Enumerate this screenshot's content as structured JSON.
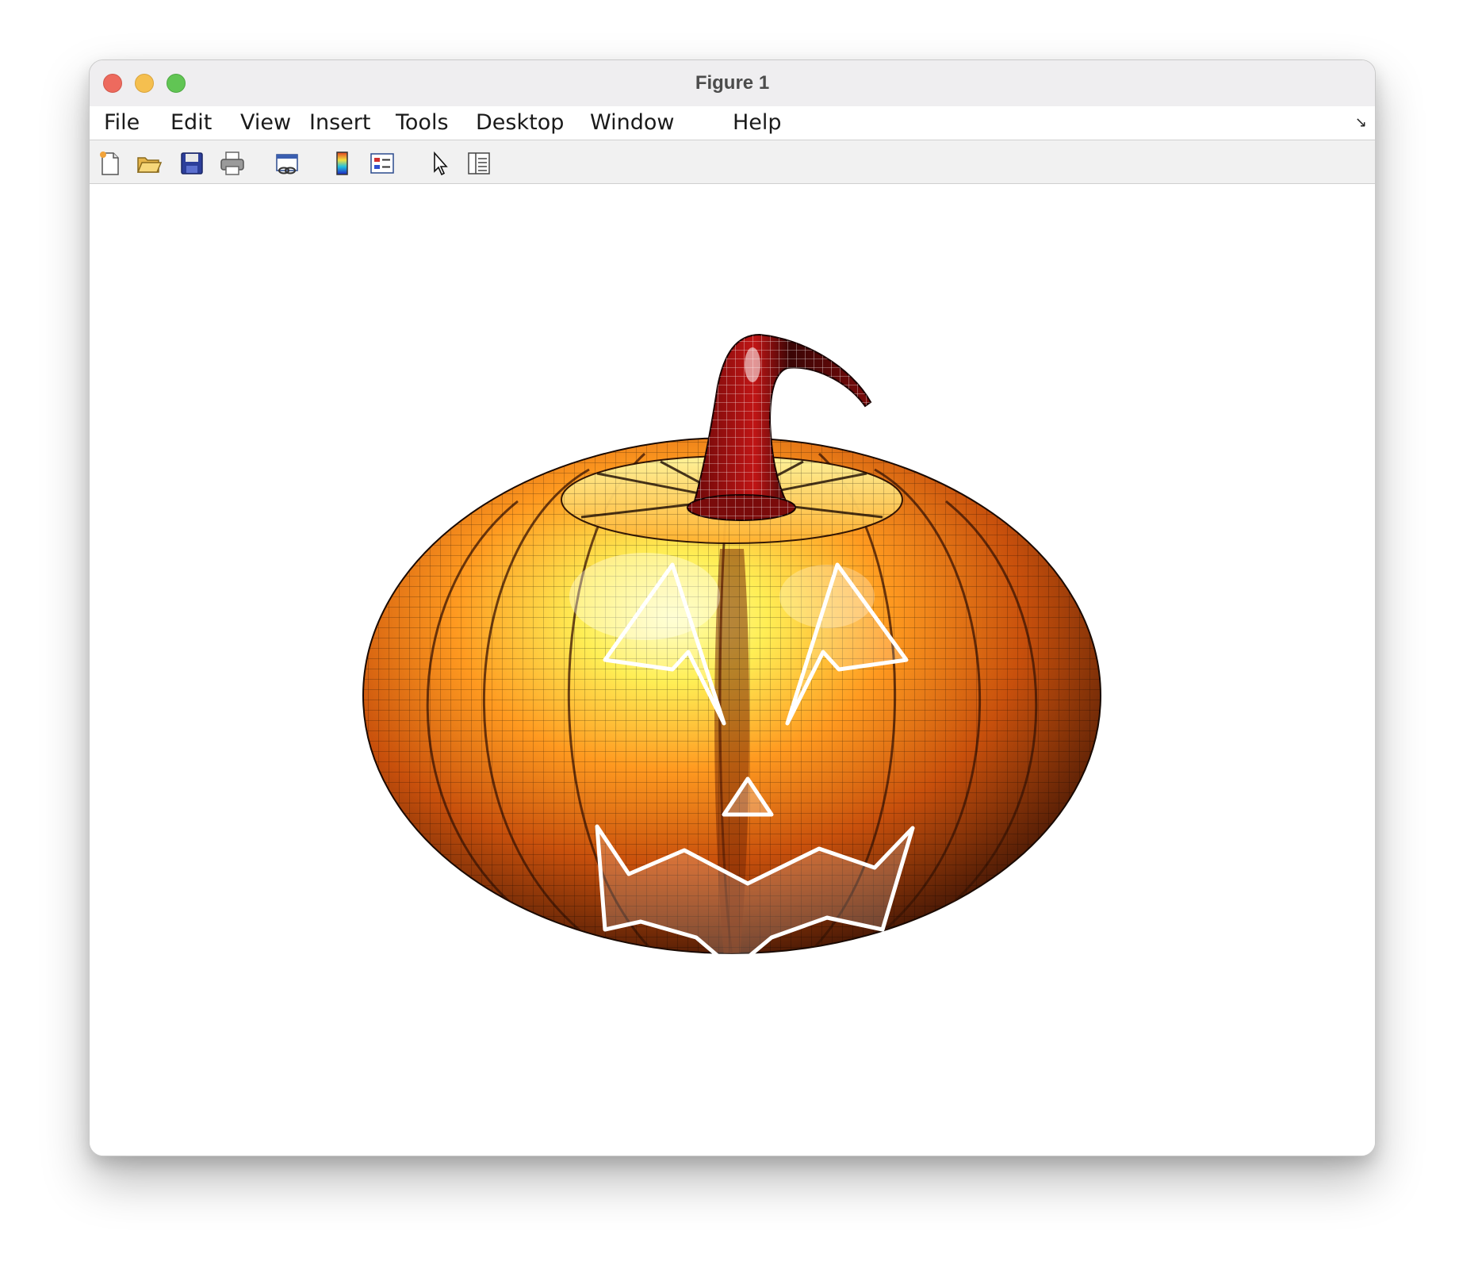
{
  "window": {
    "title": "Figure 1"
  },
  "menubar": {
    "items": [
      "File",
      "Edit",
      "View",
      "Insert",
      "Tools",
      "Desktop",
      "Window",
      "Help"
    ]
  },
  "toolbar": {
    "tools": [
      "new-figure-icon",
      "open-file-icon",
      "save-icon",
      "print-icon",
      "link-plot-icon",
      "colorbar-icon",
      "legend-icon",
      "edit-plot-arrow-icon",
      "property-inspector-icon"
    ]
  },
  "figure": {
    "subject": "3D pumpkin surface plot with carved jack-o-lantern face and curved stem",
    "colors": {
      "pumpkin_highlight": "#ffff80",
      "pumpkin_mid": "#ff8c1a",
      "pumpkin_shadow": "#4a1a05",
      "stem": "#8b0f0f",
      "mesh": "#000000",
      "carving": "#ffffff"
    }
  }
}
